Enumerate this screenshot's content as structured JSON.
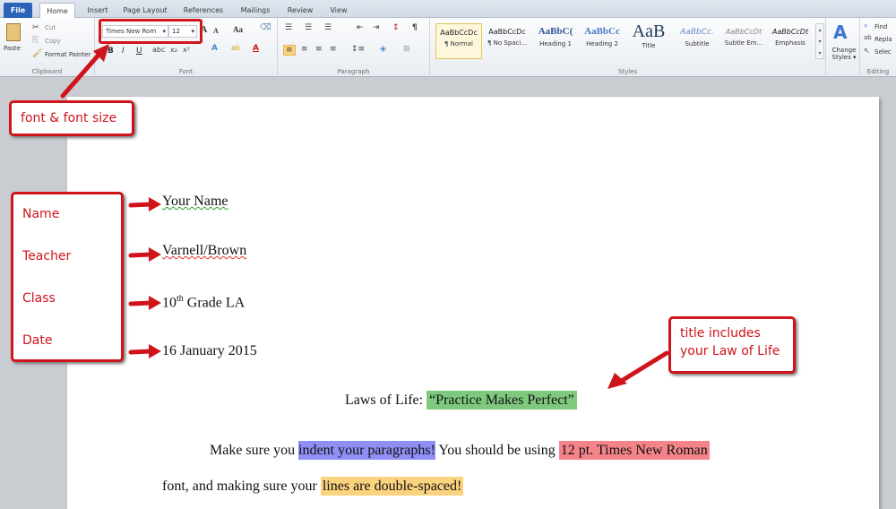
{
  "tabs": {
    "file": "File",
    "home": "Home",
    "insert": "Insert",
    "page_layout": "Page Layout",
    "references": "References",
    "mailings": "Mailings",
    "review": "Review",
    "view": "View"
  },
  "clipboard": {
    "paste": "Paste",
    "cut": "Cut",
    "copy": "Copy",
    "format_painter": "Format Painter",
    "label": "Clipboard"
  },
  "font": {
    "name": "Times New Rom",
    "size": "12",
    "label": "Font",
    "bold": "B",
    "italic": "I",
    "underline": "U",
    "grow": "A",
    "shrink": "A",
    "case": "Aa"
  },
  "paragraph": {
    "label": "Paragraph",
    "pilcrow": "¶"
  },
  "styles": {
    "label": "Styles",
    "items": [
      {
        "sample": "AaBbCcDc",
        "name": "¶ Normal"
      },
      {
        "sample": "AaBbCcDc",
        "name": "¶ No Spaci..."
      },
      {
        "sample": "AaBbC(",
        "name": "Heading 1"
      },
      {
        "sample": "AaBbCc",
        "name": "Heading 2"
      },
      {
        "sample": "AaB",
        "name": "Title"
      },
      {
        "sample": "AaBbCc.",
        "name": "Subtitle"
      },
      {
        "sample": "AaBbCcDt",
        "name": "Subtle Em..."
      },
      {
        "sample": "AaBbCcDt",
        "name": "Emphasis"
      }
    ],
    "change_styles": "Change Styles ▾"
  },
  "editing": {
    "find": "Find",
    "replace": "Repla",
    "select": "Selec",
    "label": "Editing"
  },
  "callouts": {
    "font": "font & font size",
    "heading_labels": [
      "Name",
      "Teacher",
      "Class",
      "Date"
    ],
    "title": [
      "title includes",
      "your Law of Life"
    ]
  },
  "doc": {
    "name": "Your Name",
    "teacher": "Varnell/Brown",
    "class_num": "10",
    "class_sup": "th",
    "class_rest": " Grade LA",
    "date": "16 January 2015",
    "title_prefix": "Laws of Life: ",
    "title_hl": "“Practice Makes Perfect”",
    "p1_a": "Make sure you ",
    "p1_hl1": "indent your paragraphs!",
    "p1_b": " You should be using ",
    "p1_hl2": "12 pt. Times New Roman",
    "p2_a": "font, and making sure your ",
    "p2_hl": "lines are double-spaced!"
  },
  "colors": {
    "accent": "#d0141b",
    "file_tab": "#2a63b8"
  }
}
